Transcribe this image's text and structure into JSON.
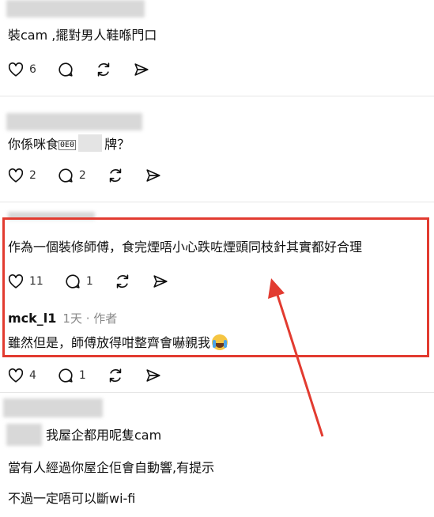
{
  "posts": [
    {
      "text": "裝cam ,擺對男人鞋喺門口",
      "likes": "6",
      "replies": ""
    },
    {
      "text_before": "你係咪食",
      "text_glyph": "0E0",
      "text_after": "牌？",
      "likes": "2",
      "replies": "2"
    },
    {
      "text": "作為一個裝修師傅，食完煙唔小心跌咗煙頭同枝針其實都好合理",
      "likes": "11",
      "replies": "1",
      "reply": {
        "author": "mck_l1",
        "meta": "1天 · 作者",
        "text": "雖然但是，師傅放得咁整齊會嚇親我"
      },
      "after_likes": "4",
      "after_replies": "1"
    },
    {
      "line1": "我屋企都用呢隻cam",
      "line2": "當有人經過你屋企佢會自動響,有提示",
      "line3": "不過一定唔可以斷wi-fi"
    }
  ],
  "annotation": {
    "box_color": "#e23b30",
    "arrow_color": "#e23b30"
  },
  "icons": [
    "heart-icon",
    "comment-icon",
    "repost-icon",
    "share-icon",
    "crying-emoji"
  ]
}
